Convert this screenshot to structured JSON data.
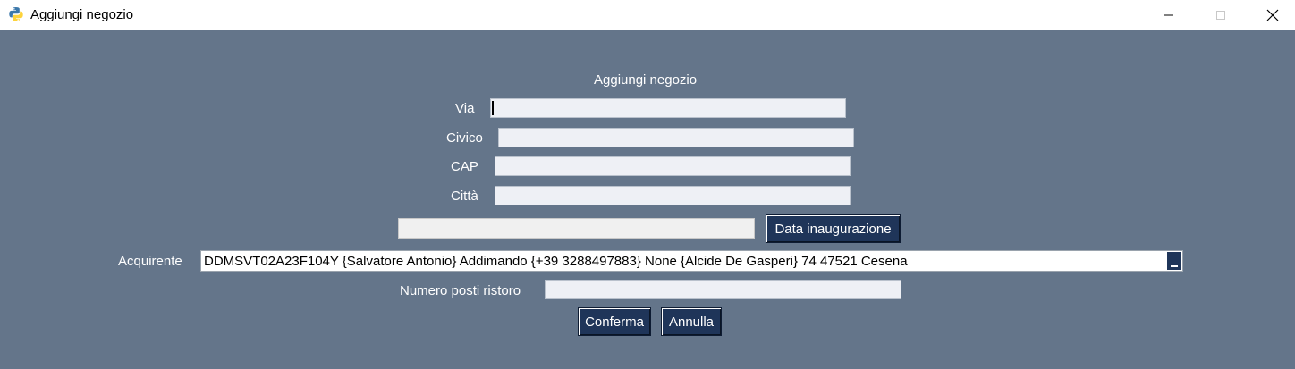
{
  "window": {
    "title": "Aggiungi negozio",
    "controls": {
      "minimize": "minimize-icon",
      "maximize": "maximize-icon",
      "close": "close-icon"
    }
  },
  "form": {
    "heading": "Aggiungi negozio",
    "via": {
      "label": "Via",
      "value": ""
    },
    "civico": {
      "label": "Civico",
      "value": ""
    },
    "cap": {
      "label": "CAP",
      "value": ""
    },
    "citta": {
      "label": "Città",
      "value": ""
    },
    "data_inaugurazione": {
      "value": "",
      "button_label": "Data inaugurazione"
    },
    "acquirente": {
      "label": "Acquirente",
      "selected": "DDMSVT02A23F104Y {Salvatore Antonio} Addimando {+39 3288497883} None {Alcide De Gasperi} 74 47521 Cesena"
    },
    "numero_posti_ristoro": {
      "label": "Numero posti ristoro",
      "value": ""
    },
    "conferma_label": "Conferma",
    "annulla_label": "Annulla"
  },
  "colors": {
    "background": "#64758a",
    "button": "#1f3559",
    "field": "#eef0f5"
  }
}
